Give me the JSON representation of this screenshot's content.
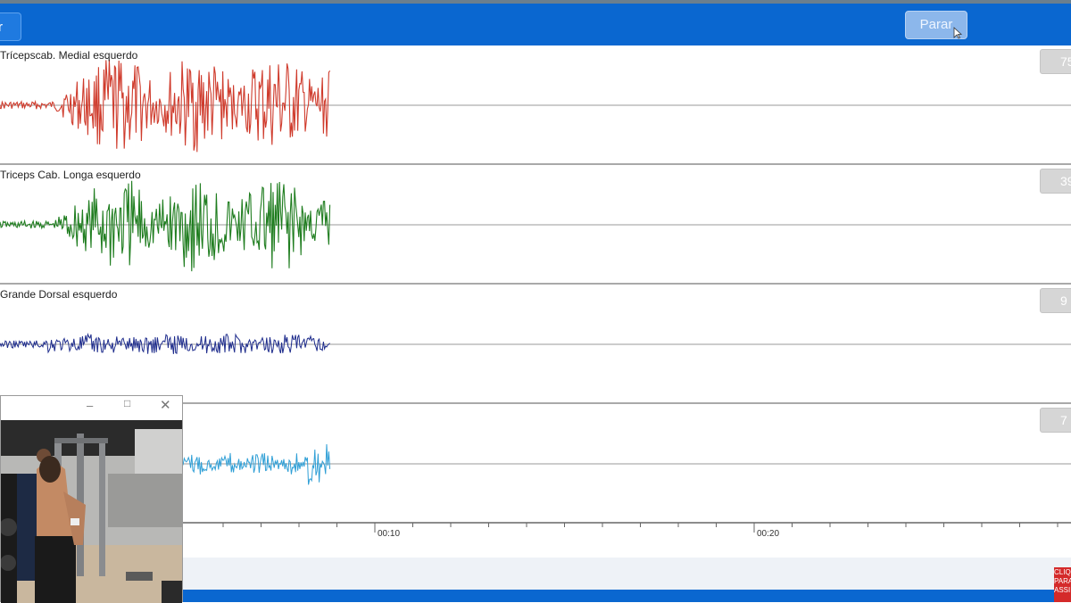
{
  "toolbar": {
    "left_button_label": "r",
    "stop_button_label": "Parar"
  },
  "channels": [
    {
      "label": "Trícepscab. Medial esquerdo",
      "value": "75",
      "color": "#cf3b2c",
      "amplitude": 1.0,
      "noise": 0.08
    },
    {
      "label": "Triceps Cab. Longa esquerdo",
      "value": "39",
      "color": "#1f7d1f",
      "amplitude": 0.9,
      "noise": 0.08
    },
    {
      "label": "Grande Dorsal esquerdo",
      "value": "9",
      "color": "#1e2c8c",
      "amplitude": 0.22,
      "noise": 0.05
    },
    {
      "label": "",
      "value": "7",
      "color": "#2f9fd6",
      "amplitude": 0.35,
      "noise": 0.05
    }
  ],
  "axis": {
    "tick_labels": [
      "00:10",
      "00:20"
    ]
  },
  "badge_text": "CLIQ PARA ASSI",
  "video_window": {
    "minimize_icon": "minimize-icon",
    "maximize_icon": "maximize-icon",
    "close_icon": "close-icon"
  }
}
